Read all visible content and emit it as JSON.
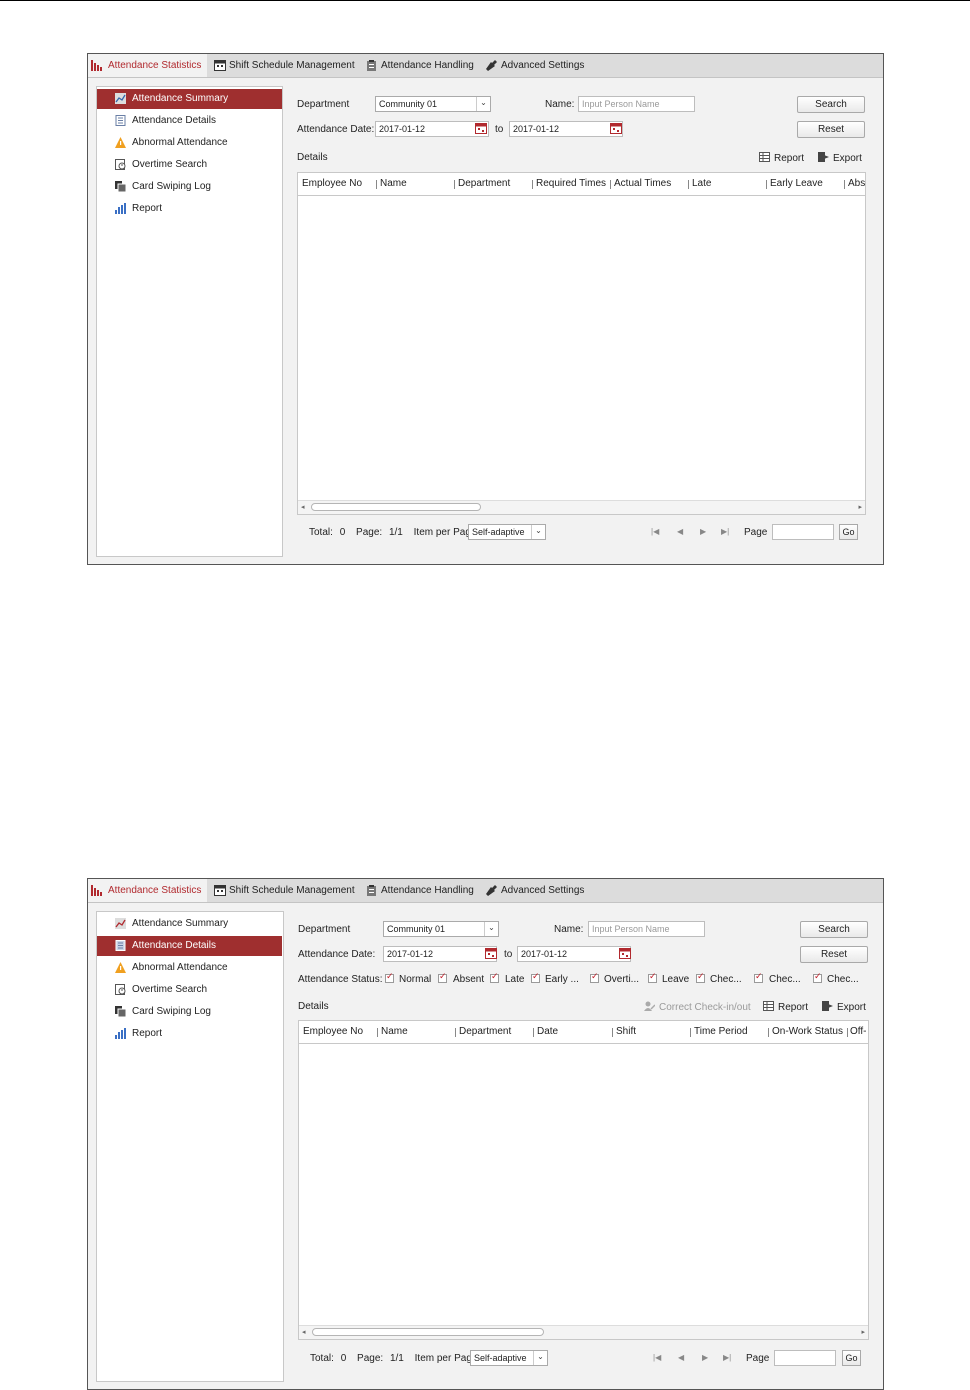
{
  "tabs": {
    "stats": "Attendance Statistics",
    "shift": "Shift Schedule Management",
    "handling": "Attendance Handling",
    "advanced": "Advanced Settings"
  },
  "nav": {
    "summary": "Attendance Summary",
    "details": "Attendance Details",
    "abnormal": "Abnormal Attendance",
    "overtime": "Overtime Search",
    "card": "Card Swiping Log",
    "report": "Report"
  },
  "form": {
    "department_label": "Department",
    "department_value": "Community 01",
    "name_label": "Name:",
    "name_placeholder": "Input Person Name",
    "date_label": "Attendance Date:",
    "date_from": "2017-01-12",
    "to_label": "to",
    "date_to": "2017-01-12",
    "search": "Search",
    "reset": "Reset",
    "status_label": "Attendance Status:"
  },
  "toolbar": {
    "details": "Details",
    "report": "Report",
    "export": "Export",
    "correct": "Correct Check-in/out"
  },
  "summary_columns": [
    "Employee No",
    "Name",
    "Department",
    "Required Times",
    "Actual Times",
    "Late",
    "Early Leave",
    "Abs"
  ],
  "details_columns": [
    "Employee No",
    "Name",
    "Department",
    "Date",
    "Shift",
    "Time Period",
    "On-Work Status",
    "Off-"
  ],
  "status_options": [
    "Normal",
    "Absent",
    "Late",
    "Early ...",
    "Overti...",
    "Leave",
    "Chec...",
    "Chec...",
    "Chec..."
  ],
  "pager": {
    "total_label": "Total:",
    "total_value": "0",
    "page_label": "Page:",
    "page_value": "1/1",
    "per_page_label": "Item per Page:",
    "per_page_value": "Self-adaptive",
    "goto_label": "Page",
    "go": "Go"
  },
  "colors": {
    "accent": "#9f2f2f",
    "tab_active_text": "#b1292e"
  }
}
